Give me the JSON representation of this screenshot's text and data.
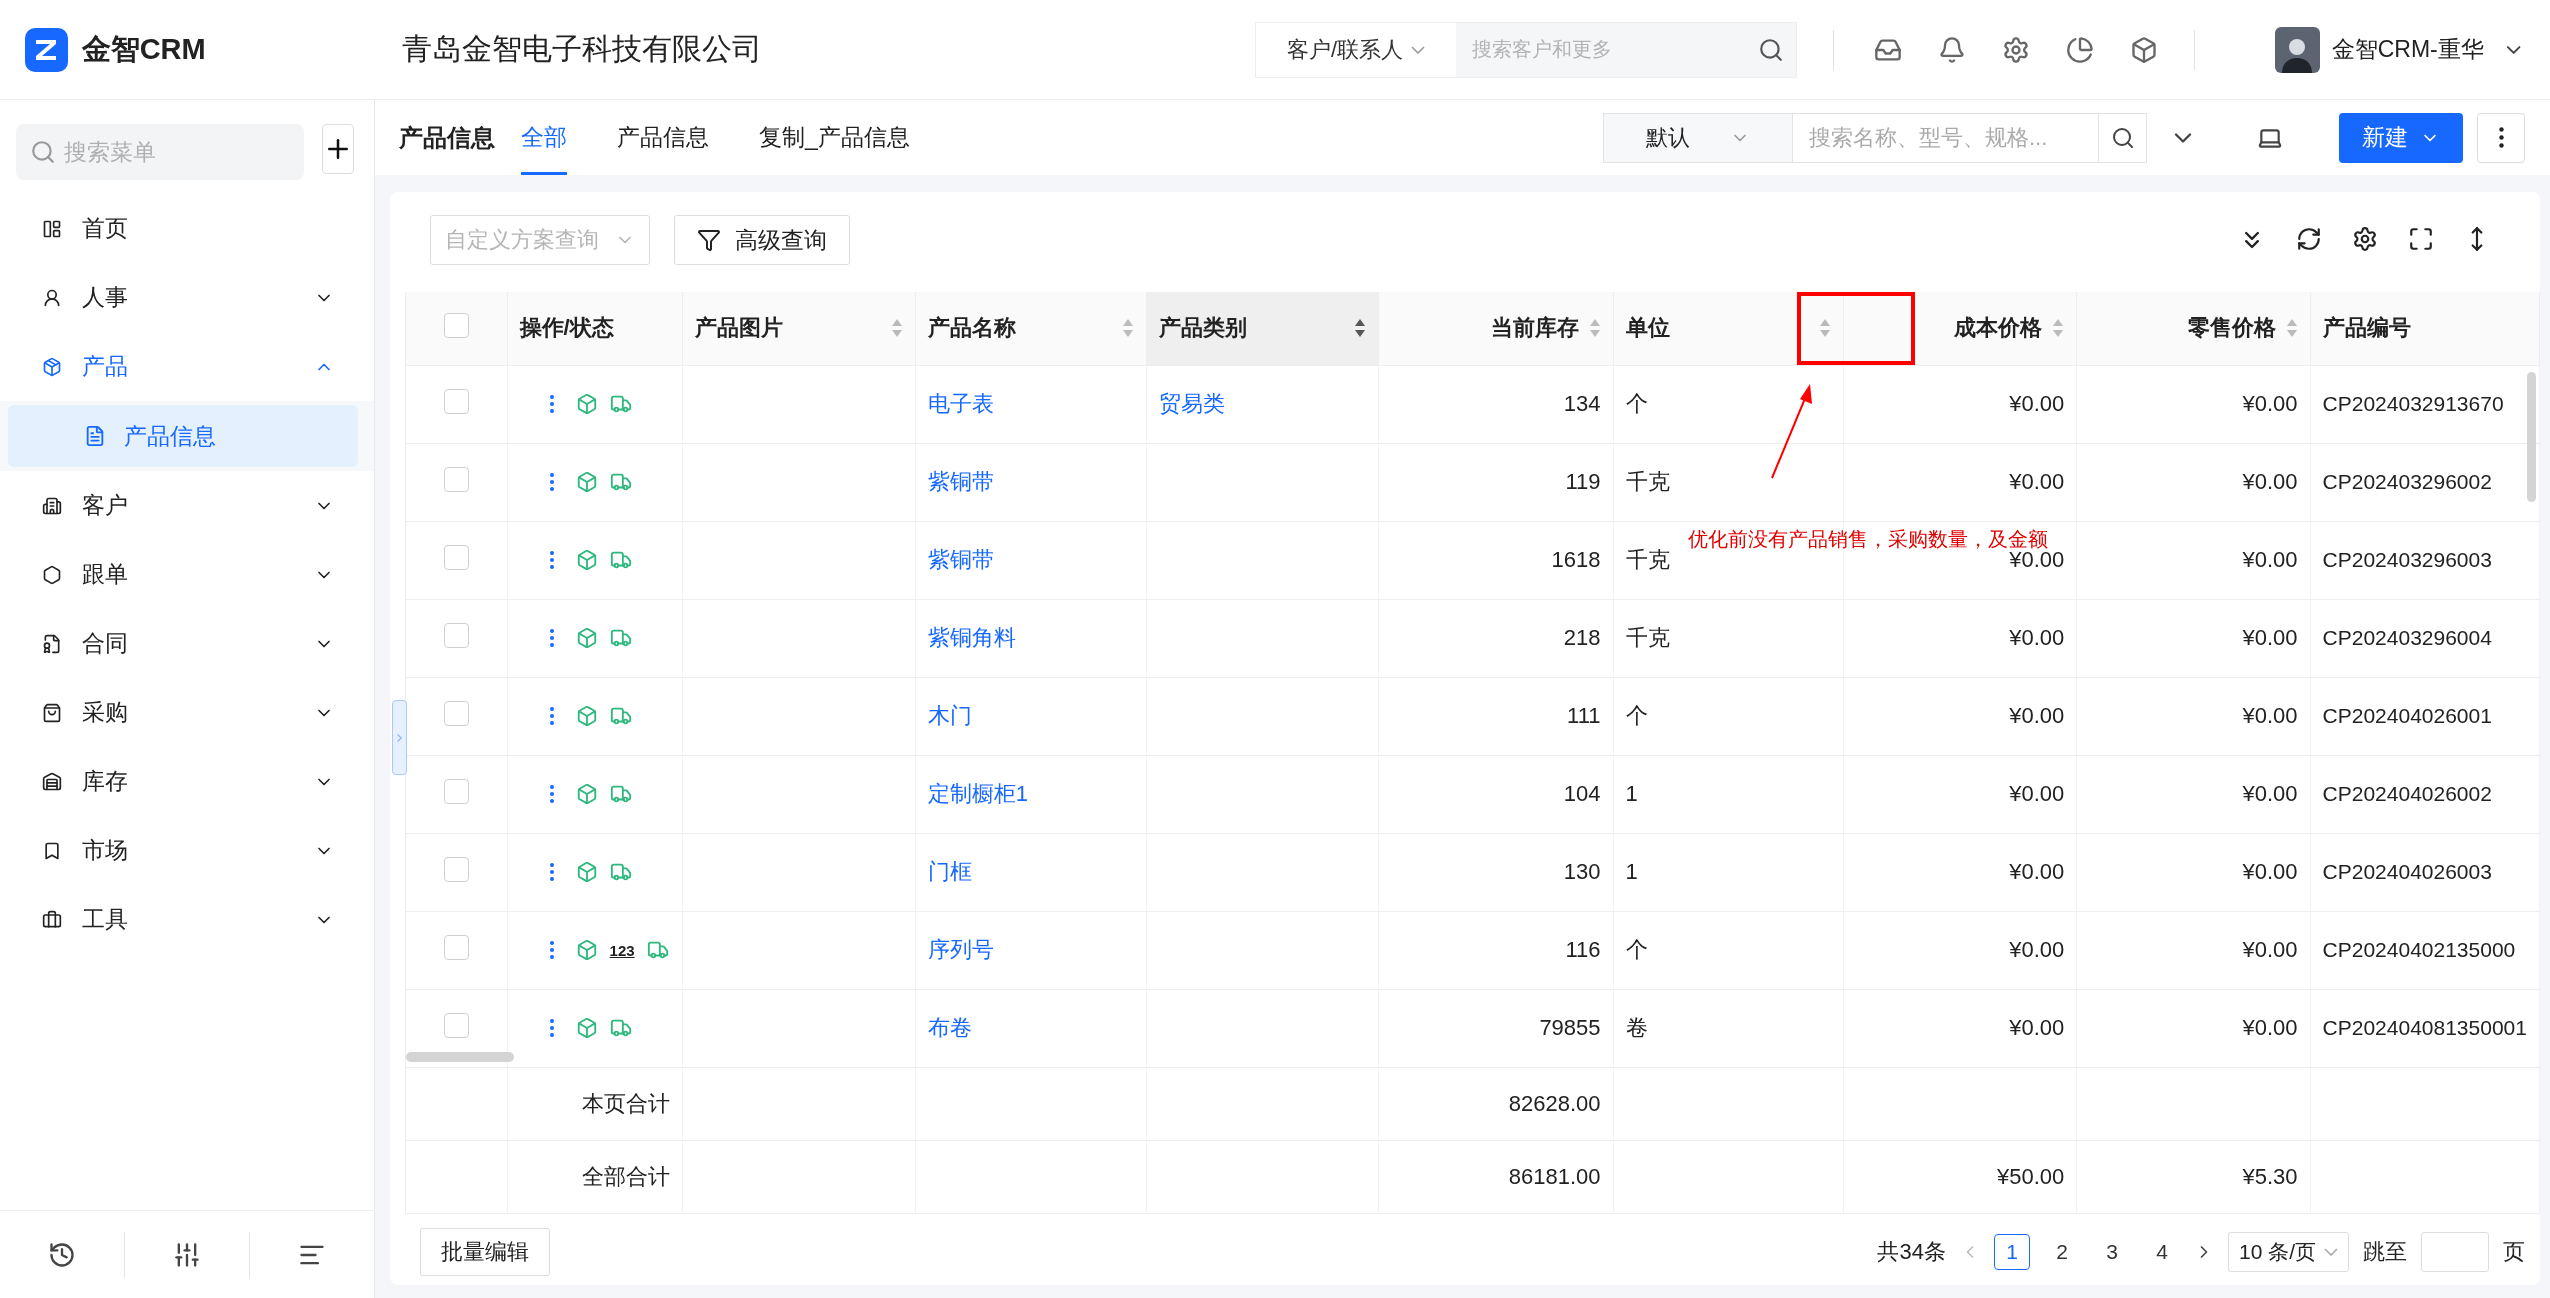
{
  "header": {
    "logo_text": "金智CRM",
    "company": "青岛金智电子科技有限公司",
    "search_scope": "客户/联系人",
    "search_placeholder": "搜索客户和更多",
    "user_name": "金智CRM-重华"
  },
  "sidebar": {
    "search_placeholder": "搜索菜单",
    "items": [
      {
        "label": "首页",
        "kind": "link",
        "selected": false
      },
      {
        "label": "人事",
        "kind": "group",
        "selected": false,
        "expanded": false
      },
      {
        "label": "产品",
        "kind": "group",
        "selected": true,
        "expanded": true,
        "children": [
          {
            "label": "产品信息",
            "selected": true
          }
        ]
      },
      {
        "label": "客户",
        "kind": "group",
        "selected": false,
        "expanded": false
      },
      {
        "label": "跟单",
        "kind": "group",
        "selected": false,
        "expanded": false
      },
      {
        "label": "合同",
        "kind": "group",
        "selected": false,
        "expanded": false
      },
      {
        "label": "采购",
        "kind": "group",
        "selected": false,
        "expanded": false
      },
      {
        "label": "库存",
        "kind": "group",
        "selected": false,
        "expanded": false
      },
      {
        "label": "市场",
        "kind": "group",
        "selected": false,
        "expanded": false
      },
      {
        "label": "工具",
        "kind": "group",
        "selected": false,
        "expanded": false
      }
    ]
  },
  "page": {
    "title": "产品信息",
    "tabs": [
      {
        "label": "全部",
        "selected": true
      },
      {
        "label": "产品信息",
        "selected": false
      },
      {
        "label": "复制_产品信息",
        "selected": false
      }
    ],
    "view_select": "默认",
    "search_placeholder": "搜索名称、型号、规格...",
    "new_button": "新建"
  },
  "toolbar": {
    "scheme_placeholder": "自定义方案查询",
    "advanced_button": "高级查询"
  },
  "table": {
    "all_checked": false,
    "columns": [
      {
        "label": "操作/状态",
        "sortable": false
      },
      {
        "label": "产品图片",
        "sortable": true,
        "sorted": false
      },
      {
        "label": "产品名称",
        "sortable": true,
        "sorted": false
      },
      {
        "label": "产品类别",
        "sortable": true,
        "sorted": true
      },
      {
        "label": "当前库存",
        "sortable": true,
        "sorted": false
      },
      {
        "label": "单位",
        "sortable": true,
        "sorted": false
      },
      {
        "label": "成本价格",
        "sortable": true,
        "sorted": false
      },
      {
        "label": "零售价格",
        "sortable": true,
        "sorted": false
      },
      {
        "label": "产品编号",
        "sortable": false
      }
    ],
    "rows": [
      {
        "checked": false,
        "name": "电子表",
        "category": "贸易类",
        "stock": "134",
        "unit": "个",
        "cost": "¥0.00",
        "retail": "¥0.00",
        "code": "CP2024032913670"
      },
      {
        "checked": false,
        "name": "紫铜带",
        "stock": "119",
        "unit": "千克",
        "cost": "¥0.00",
        "retail": "¥0.00",
        "code": "CP202403296002"
      },
      {
        "checked": false,
        "name": "紫铜带",
        "stock": "1618",
        "unit": "千克",
        "cost": "¥0.00",
        "retail": "¥0.00",
        "code": "CP202403296003"
      },
      {
        "checked": false,
        "name": "紫铜角料",
        "stock": "218",
        "unit": "千克",
        "cost": "¥0.00",
        "retail": "¥0.00",
        "code": "CP202403296004"
      },
      {
        "checked": false,
        "name": "木门",
        "stock": "111",
        "unit": "个",
        "cost": "¥0.00",
        "retail": "¥0.00",
        "code": "CP202404026001"
      },
      {
        "checked": false,
        "name": "定制橱柜1",
        "stock": "104",
        "unit": "1",
        "cost": "¥0.00",
        "retail": "¥0.00",
        "code": "CP202404026002"
      },
      {
        "checked": false,
        "name": "门框",
        "stock": "130",
        "unit": "1",
        "cost": "¥0.00",
        "retail": "¥0.00",
        "code": "CP202404026003"
      },
      {
        "checked": false,
        "name": "序列号",
        "badge": "123",
        "stock": "116",
        "unit": "个",
        "cost": "¥0.00",
        "retail": "¥0.00",
        "code": "CP20240402135000"
      },
      {
        "checked": false,
        "name": "布卷",
        "stock": "79855",
        "unit": "卷",
        "cost": "¥0.00",
        "retail": "¥0.00",
        "code": "CP202404081350001"
      }
    ],
    "totals": [
      {
        "label": "本页合计",
        "stock": "82628.00"
      },
      {
        "label": "全部合计",
        "stock": "86181.00",
        "cost": "¥50.00",
        "retail": "¥5.30"
      }
    ]
  },
  "footer": {
    "batch_button": "批量编辑",
    "total": "共34条",
    "pages": [
      {
        "label": "1",
        "selected": true
      },
      {
        "label": "2",
        "selected": false
      },
      {
        "label": "3",
        "selected": false
      },
      {
        "label": "4",
        "selected": false
      }
    ],
    "page_size": "10 条/页",
    "jump_label": "跳至",
    "page_unit": "页"
  },
  "annotation": {
    "text": "优化前没有产品销售，采购数量，及金额"
  }
}
